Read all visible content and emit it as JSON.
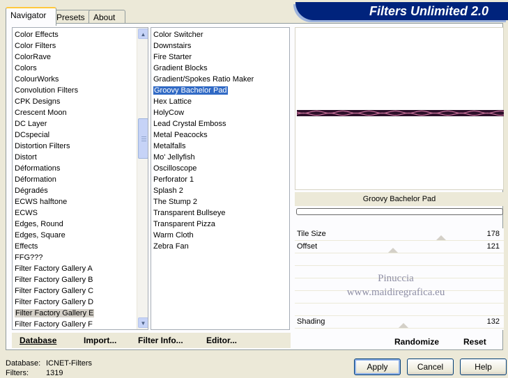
{
  "tabs": [
    {
      "label": "Navigator"
    },
    {
      "label": "Presets"
    },
    {
      "label": "About"
    }
  ],
  "banner": {
    "title": "Filters Unlimited 2.0"
  },
  "categories": [
    "Color Effects",
    "Color Filters",
    "ColorRave",
    "Colors",
    "ColourWorks",
    "Convolution Filters",
    "CPK Designs",
    "Crescent Moon",
    "DC Layer",
    "DCspecial",
    "Distortion Filters",
    "Distort",
    "Déformations",
    "Déformation",
    "Dégradés",
    "ECWS halftone",
    "ECWS",
    "Edges, Round",
    "Edges, Square",
    "Effects",
    "FFG???",
    "Filter Factory Gallery A",
    "Filter Factory Gallery B",
    "Filter Factory Gallery C",
    "Filter Factory Gallery D",
    "Filter Factory Gallery E",
    "Filter Factory Gallery F"
  ],
  "filters": [
    "Color Switcher",
    "Downstairs",
    "Fire Starter",
    "Gradient Blocks",
    "Gradient/Spokes Ratio Maker",
    "Groovy Bachelor Pad",
    "Hex Lattice",
    "HolyCow",
    "Lead Crystal Emboss",
    "Metal Peacocks",
    "Metalfalls",
    "Mo' Jellyfish",
    "Oscilloscope",
    "Perforator 1",
    "Splash 2",
    "The Stump 2",
    "Transparent Bullseye",
    "Transparent Pizza",
    "Warm Cloth",
    "Zebra Fan"
  ],
  "bottom_links": {
    "database": "Database",
    "import": "Import...",
    "filter_info": "Filter Info...",
    "editor": "Editor..."
  },
  "preview": {
    "filter_name": "Groovy Bachelor Pad",
    "wave_colors": [
      "#2e0f2a",
      "#c8709a"
    ]
  },
  "sliders": {
    "tile_size": {
      "label": "Tile Size",
      "value": "178",
      "position": 0.7
    },
    "offset": {
      "label": "Offset",
      "value": "121",
      "position": 0.47
    },
    "shading": {
      "label": "Shading",
      "value": "132",
      "position": 0.52
    }
  },
  "watermark": {
    "line1": "Pinuccia",
    "line2": "www.maidiregrafica.eu"
  },
  "actions": {
    "randomize": "Randomize",
    "reset": "Reset"
  },
  "status": {
    "database_label": "Database:",
    "database_value": "ICNET-Filters",
    "filters_label": "Filters:",
    "filters_value": "1319"
  },
  "buttons": {
    "apply": "Apply",
    "cancel": "Cancel",
    "help": "Help"
  }
}
